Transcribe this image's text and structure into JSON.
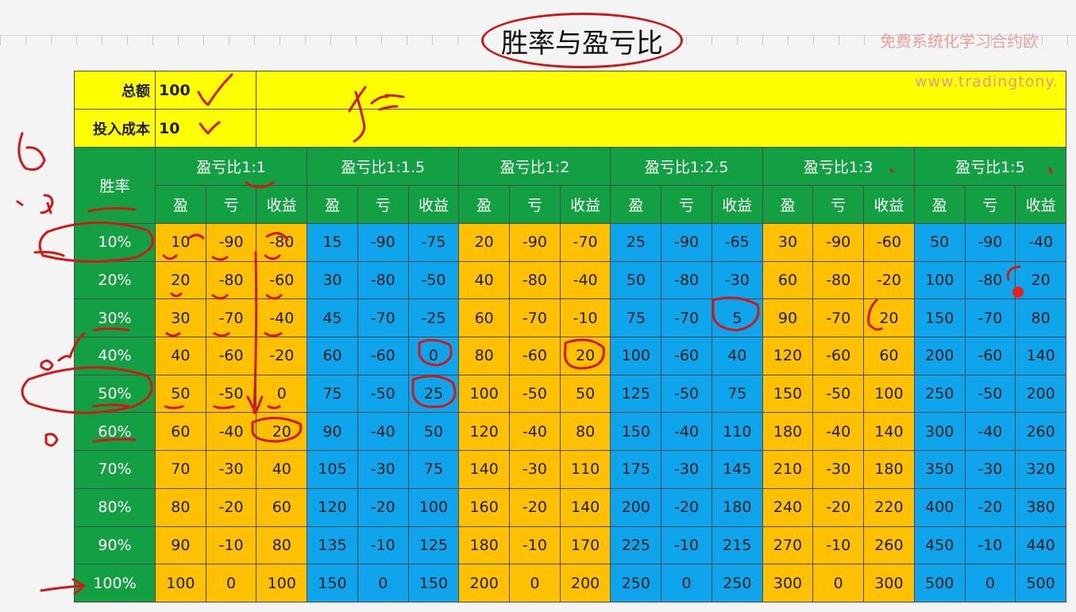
{
  "title": "胜率与盈亏比",
  "promo_text": "免费系统化学习合约欧",
  "site_url": "www.tradingtony.",
  "summary": {
    "total_label": "总额",
    "total_value": "100",
    "cost_label": "投入成本",
    "cost_value": "10"
  },
  "headers": {
    "win_rate": "胜率",
    "ratios": [
      "盈亏比1:1",
      "盈亏比1:1.5",
      "盈亏比1:2",
      "盈亏比1:2.5",
      "盈亏比1:3",
      "盈亏比1:5"
    ],
    "sub": [
      "盈",
      "亏",
      "收益"
    ]
  },
  "rows": [
    {
      "rate": "10%",
      "groups": [
        [
          "10",
          "-90",
          "-80"
        ],
        [
          "15",
          "-90",
          "-75"
        ],
        [
          "20",
          "-90",
          "-70"
        ],
        [
          "25",
          "-90",
          "-65"
        ],
        [
          "30",
          "-90",
          "-60"
        ],
        [
          "50",
          "-90",
          "-40"
        ]
      ]
    },
    {
      "rate": "20%",
      "groups": [
        [
          "20",
          "-80",
          "-60"
        ],
        [
          "30",
          "-80",
          "-50"
        ],
        [
          "40",
          "-80",
          "-40"
        ],
        [
          "50",
          "-80",
          "-30"
        ],
        [
          "60",
          "-80",
          "-20"
        ],
        [
          "100",
          "-80",
          "20"
        ]
      ]
    },
    {
      "rate": "30%",
      "groups": [
        [
          "30",
          "-70",
          "-40"
        ],
        [
          "45",
          "-70",
          "-25"
        ],
        [
          "60",
          "-70",
          "-10"
        ],
        [
          "75",
          "-70",
          "5"
        ],
        [
          "90",
          "-70",
          "20"
        ],
        [
          "150",
          "-70",
          "80"
        ]
      ]
    },
    {
      "rate": "40%",
      "groups": [
        [
          "40",
          "-60",
          "-20"
        ],
        [
          "60",
          "-60",
          "0"
        ],
        [
          "80",
          "-60",
          "20"
        ],
        [
          "100",
          "-60",
          "40"
        ],
        [
          "120",
          "-60",
          "60"
        ],
        [
          "200",
          "-60",
          "140"
        ]
      ]
    },
    {
      "rate": "50%",
      "groups": [
        [
          "50",
          "-50",
          "0"
        ],
        [
          "75",
          "-50",
          "25"
        ],
        [
          "100",
          "-50",
          "50"
        ],
        [
          "125",
          "-50",
          "75"
        ],
        [
          "150",
          "-50",
          "100"
        ],
        [
          "250",
          "-50",
          "200"
        ]
      ]
    },
    {
      "rate": "60%",
      "groups": [
        [
          "60",
          "-40",
          "20"
        ],
        [
          "90",
          "-40",
          "50"
        ],
        [
          "120",
          "-40",
          "80"
        ],
        [
          "150",
          "-40",
          "110"
        ],
        [
          "180",
          "-40",
          "140"
        ],
        [
          "300",
          "-40",
          "260"
        ]
      ]
    },
    {
      "rate": "70%",
      "groups": [
        [
          "70",
          "-30",
          "40"
        ],
        [
          "105",
          "-30",
          "75"
        ],
        [
          "140",
          "-30",
          "110"
        ],
        [
          "175",
          "-30",
          "145"
        ],
        [
          "210",
          "-30",
          "180"
        ],
        [
          "350",
          "-30",
          "320"
        ]
      ]
    },
    {
      "rate": "80%",
      "groups": [
        [
          "80",
          "-20",
          "60"
        ],
        [
          "120",
          "-20",
          "100"
        ],
        [
          "160",
          "-20",
          "140"
        ],
        [
          "200",
          "-20",
          "180"
        ],
        [
          "240",
          "-20",
          "220"
        ],
        [
          "400",
          "-20",
          "380"
        ]
      ]
    },
    {
      "rate": "90%",
      "groups": [
        [
          "90",
          "-10",
          "80"
        ],
        [
          "135",
          "-10",
          "125"
        ],
        [
          "180",
          "-10",
          "170"
        ],
        [
          "225",
          "-10",
          "215"
        ],
        [
          "270",
          "-10",
          "260"
        ],
        [
          "450",
          "-10",
          "440"
        ]
      ]
    },
    {
      "rate": "100%",
      "groups": [
        [
          "100",
          "0",
          "100"
        ],
        [
          "150",
          "0",
          "150"
        ],
        [
          "200",
          "0",
          "200"
        ],
        [
          "250",
          "0",
          "250"
        ],
        [
          "300",
          "0",
          "300"
        ],
        [
          "500",
          "0",
          "500"
        ]
      ]
    }
  ],
  "colors": {
    "yellow": "#ffff00",
    "green": "#13a043",
    "orange": "#ffc000",
    "blue": "#0ea5ec",
    "annotation_red": "#d01818"
  }
}
